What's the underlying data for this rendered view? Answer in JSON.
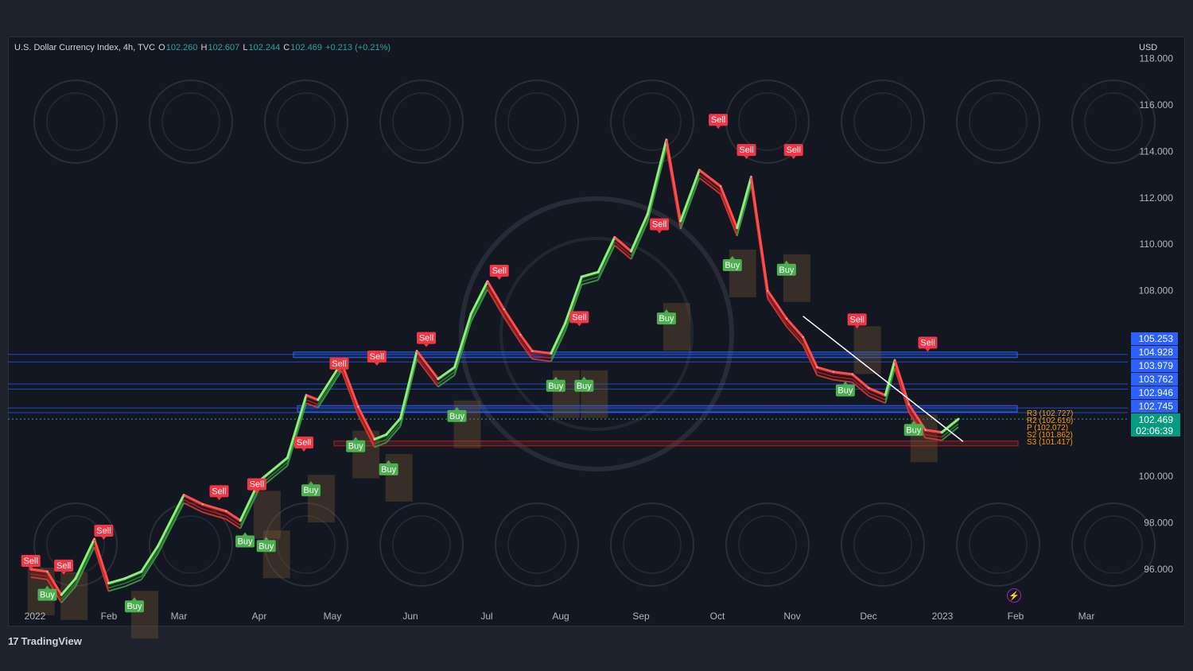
{
  "header": {
    "symbol": "U.S. Dollar Currency Index, 4h, TVC",
    "o_label": "O",
    "o_value": "102.260",
    "h_label": "H",
    "h_value": "102.607",
    "l_label": "L",
    "l_value": "102.244",
    "c_label": "C",
    "c_value": "102.469",
    "change": "+0.213 (+0.21%)"
  },
  "currency": "USD",
  "brand": {
    "logo": "17",
    "name": "TradingView"
  },
  "colors": {
    "background": "#131722",
    "up": "#26a69a",
    "buy": "#4caf50",
    "sell": "#f23645",
    "level_line": "#2962ff",
    "pivot": "#ff9800",
    "price_tag": "#089981",
    "level_tag": "#2962ff"
  },
  "chart_data": {
    "type": "line",
    "title": "U.S. Dollar Currency Index, 4h, TVC",
    "xlabel": "",
    "ylabel": "",
    "ylim": [
      95,
      118.5
    ],
    "x_ticks": [
      "2022",
      "Feb",
      "Mar",
      "Apr",
      "May",
      "Jun",
      "Jul",
      "Aug",
      "Sep",
      "Oct",
      "Nov",
      "Dec",
      "2023",
      "Feb",
      "Mar"
    ],
    "y_ticks": [
      "118.000",
      "116.000",
      "114.000",
      "112.000",
      "110.000",
      "108.000",
      "100.000",
      "98.000",
      "96.000"
    ],
    "series": [
      {
        "values": [
          [
            "2022-01-01",
            96.0
          ],
          [
            "2022-01-08",
            95.9
          ],
          [
            "2022-01-14",
            94.9
          ],
          [
            "2022-01-20",
            95.6
          ],
          [
            "2022-01-28",
            97.3
          ],
          [
            "2022-02-03",
            95.4
          ],
          [
            "2022-02-10",
            95.6
          ],
          [
            "2022-02-17",
            95.9
          ],
          [
            "2022-02-24",
            97.0
          ],
          [
            "2022-03-07",
            99.2
          ],
          [
            "2022-03-15",
            98.8
          ],
          [
            "2022-03-25",
            98.5
          ],
          [
            "2022-03-31",
            98.1
          ],
          [
            "2022-04-08",
            99.8
          ],
          [
            "2022-04-20",
            100.8
          ],
          [
            "2022-04-28",
            103.5
          ],
          [
            "2022-05-03",
            103.3
          ],
          [
            "2022-05-13",
            104.9
          ],
          [
            "2022-05-20",
            103.0
          ],
          [
            "2022-05-27",
            101.6
          ],
          [
            "2022-06-01",
            101.8
          ],
          [
            "2022-06-07",
            102.5
          ],
          [
            "2022-06-14",
            105.4
          ],
          [
            "2022-06-23",
            104.2
          ],
          [
            "2022-06-30",
            104.7
          ],
          [
            "2022-07-07",
            107.0
          ],
          [
            "2022-07-14",
            108.4
          ],
          [
            "2022-07-21",
            107.2
          ],
          [
            "2022-07-28",
            106.1
          ],
          [
            "2022-08-02",
            105.4
          ],
          [
            "2022-08-10",
            105.3
          ],
          [
            "2022-08-16",
            106.6
          ],
          [
            "2022-08-23",
            108.6
          ],
          [
            "2022-08-30",
            108.8
          ],
          [
            "2022-09-06",
            110.3
          ],
          [
            "2022-09-13",
            109.7
          ],
          [
            "2022-09-20",
            111.3
          ],
          [
            "2022-09-28",
            114.5
          ],
          [
            "2022-10-04",
            111.0
          ],
          [
            "2022-10-12",
            113.2
          ],
          [
            "2022-10-21",
            112.5
          ],
          [
            "2022-10-28",
            110.7
          ],
          [
            "2022-11-03",
            112.9
          ],
          [
            "2022-11-10",
            108.0
          ],
          [
            "2022-11-18",
            106.8
          ],
          [
            "2022-11-25",
            106.0
          ],
          [
            "2022-12-01",
            104.7
          ],
          [
            "2022-12-08",
            104.5
          ],
          [
            "2022-12-16",
            104.4
          ],
          [
            "2022-12-23",
            103.8
          ],
          [
            "2022-12-30",
            103.5
          ],
          [
            "2023-01-03",
            105.0
          ],
          [
            "2023-01-09",
            103.1
          ],
          [
            "2023-01-16",
            102.0
          ],
          [
            "2023-01-23",
            101.9
          ],
          [
            "2023-01-30",
            102.469
          ]
        ]
      }
    ],
    "signals": [
      {
        "type": "Sell",
        "date": "2022-01-01",
        "price": 96.0
      },
      {
        "type": "Buy",
        "date": "2022-01-08",
        "price": 95.5
      },
      {
        "type": "Sell",
        "date": "2022-01-15",
        "price": 95.8
      },
      {
        "type": "Sell",
        "date": "2022-02-01",
        "price": 97.3
      },
      {
        "type": "Buy",
        "date": "2022-02-14",
        "price": 95.0
      },
      {
        "type": "Sell",
        "date": "2022-03-22",
        "price": 99.0
      },
      {
        "type": "Sell",
        "date": "2022-04-07",
        "price": 99.3
      },
      {
        "type": "Buy",
        "date": "2022-04-02",
        "price": 97.8
      },
      {
        "type": "Buy",
        "date": "2022-04-11",
        "price": 97.6
      },
      {
        "type": "Sell",
        "date": "2022-04-27",
        "price": 101.1
      },
      {
        "type": "Buy",
        "date": "2022-04-30",
        "price": 100.0
      },
      {
        "type": "Sell",
        "date": "2022-05-12",
        "price": 104.5
      },
      {
        "type": "Buy",
        "date": "2022-05-19",
        "price": 101.9
      },
      {
        "type": "Sell",
        "date": "2022-05-28",
        "price": 104.8
      },
      {
        "type": "Buy",
        "date": "2022-06-02",
        "price": 100.9
      },
      {
        "type": "Sell",
        "date": "2022-06-18",
        "price": 105.6
      },
      {
        "type": "Buy",
        "date": "2022-07-01",
        "price": 103.2
      },
      {
        "type": "Sell",
        "date": "2022-07-19",
        "price": 108.5
      },
      {
        "type": "Buy",
        "date": "2022-08-12",
        "price": 104.5
      },
      {
        "type": "Sell",
        "date": "2022-08-22",
        "price": 106.5
      },
      {
        "type": "Buy",
        "date": "2022-08-24",
        "price": 104.5
      },
      {
        "type": "Sell",
        "date": "2022-09-25",
        "price": 110.5
      },
      {
        "type": "Buy",
        "date": "2022-09-28",
        "price": 107.4
      },
      {
        "type": "Sell",
        "date": "2022-10-20",
        "price": 115.0
      },
      {
        "type": "Buy",
        "date": "2022-10-26",
        "price": 109.7
      },
      {
        "type": "Sell",
        "date": "2022-11-01",
        "price": 113.7
      },
      {
        "type": "Buy",
        "date": "2022-11-18",
        "price": 109.5
      },
      {
        "type": "Sell",
        "date": "2022-11-21",
        "price": 113.7
      },
      {
        "type": "Sell",
        "date": "2022-12-18",
        "price": 106.4
      },
      {
        "type": "Buy",
        "date": "2022-12-13",
        "price": 104.3
      },
      {
        "type": "Buy",
        "date": "2023-01-11",
        "price": 102.6
      },
      {
        "type": "Sell",
        "date": "2023-01-17",
        "price": 105.4
      }
    ],
    "levels": [
      "105.253",
      "104.928",
      "103.979",
      "103.762",
      "102.946",
      "102.745"
    ],
    "current_price": "102.469",
    "countdown": "02:06:39",
    "pivots": [
      "R3 (102.727)",
      "R2 (102.616)",
      "P (102.072)",
      "S2 (101.862)",
      "S3 (101.417)"
    ],
    "grid": false
  }
}
